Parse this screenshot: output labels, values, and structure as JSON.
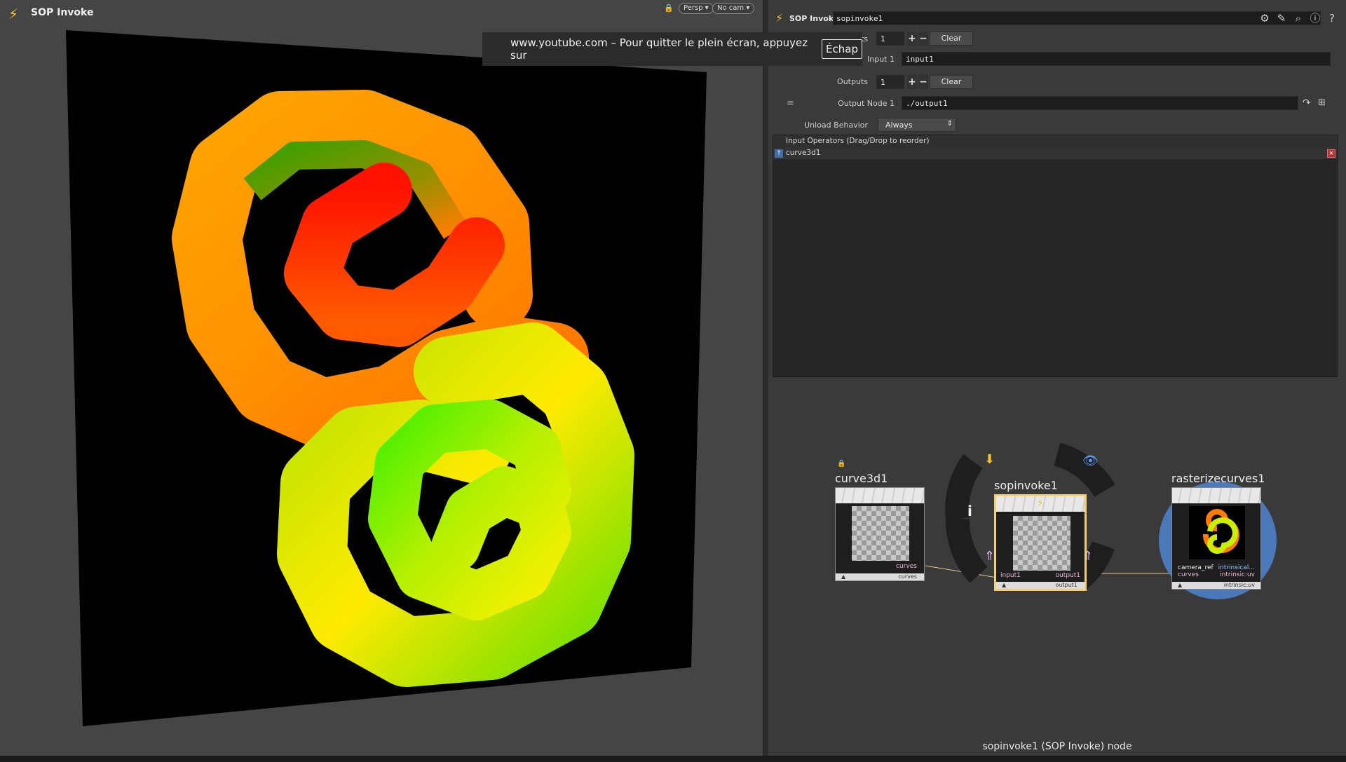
{
  "app": {
    "viewport_title": "SOP Invoke",
    "viewport_chips": [
      "Persp ▾",
      "No cam ▾"
    ]
  },
  "fullscreen_notice": {
    "text": "www.youtube.com – Pour quitter le plein écran, appuyez sur",
    "key": "Échap"
  },
  "params": {
    "type_label": "SOP Invoke",
    "node_name": "sopinvoke1",
    "inputs_label_partial": "ts",
    "inputs_value": "1",
    "input1_label": "Input 1",
    "input1_value": "input1",
    "outputs_label": "Outputs",
    "outputs_value": "1",
    "clear_label": "Clear",
    "output_node_label": "Output Node 1",
    "output_node_value": "./output1",
    "unload_label": "Unload Behavior",
    "unload_value": "Always",
    "ops_header": "Input Operators (Drag/Drop to reorder)",
    "ops_items": [
      "curve3d1"
    ]
  },
  "network": {
    "nodes": [
      {
        "name": "curve3d1",
        "out_port": "curves",
        "foot": "curves"
      },
      {
        "name": "sopinvoke1",
        "in_port": "input1",
        "out_port": "output1",
        "foot": "output1"
      },
      {
        "name": "rasterizecurves1",
        "in_port_1": "camera_ref",
        "in_port_2": "curves",
        "out_port_1": "intrinsical...",
        "out_port_2": "intrinsic:uv",
        "foot": "intrinsic:uv"
      }
    ],
    "status": "sopinvoke1 (SOP Invoke) node"
  },
  "colors": {
    "accent": "#f2c230",
    "spiral_red": "#ff1a00",
    "spiral_orange": "#ff9a00",
    "spiral_yellow": "#ffee00",
    "spiral_green": "#33ee00"
  }
}
